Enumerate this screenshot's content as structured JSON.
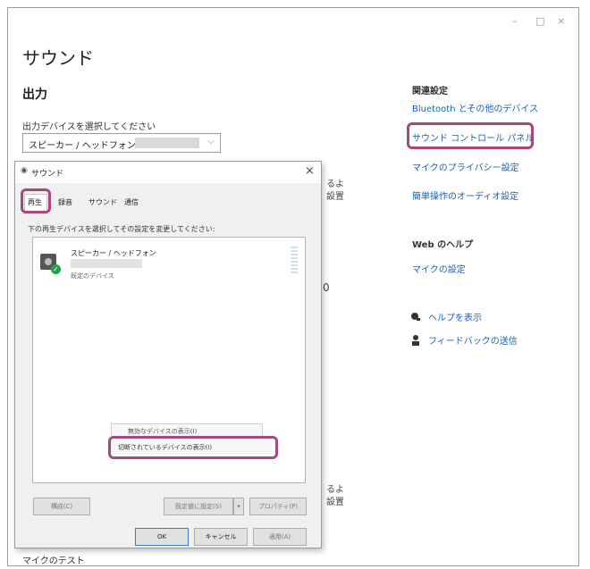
{
  "window": {
    "controls": {
      "minimize": "–",
      "maximize": "□",
      "close": "×"
    },
    "title": "サウンド",
    "output_heading": "出力",
    "output_device_label": "出力デバイスを選択してください",
    "output_device_value": "スピーカー / ヘッドフォン",
    "behind_fragments": {
      "a": "るよ",
      "b": "設置",
      "c": "0",
      "d": "るよ",
      "e": "設置"
    },
    "bottom_label": "マイクのテスト"
  },
  "related": {
    "heading": "関連設定",
    "links": [
      "Bluetooth とその他のデバイス",
      "サウンド コントロール パネル",
      "マイクのプライバシー設定",
      "簡単操作のオーディオ設定"
    ]
  },
  "web_help": {
    "heading": "Web のヘルプ",
    "link": "マイクの設定"
  },
  "help_items": [
    {
      "icon": "help-icon",
      "label": "ヘルプを表示"
    },
    {
      "icon": "feedback-icon",
      "label": "フィードバックの送信"
    }
  ],
  "dialog": {
    "title": "サウンド",
    "close": "×",
    "tabs": [
      "再生",
      "録音",
      "サウンド",
      "通信"
    ],
    "instruction": "下の再生デバイスを選択してその設定を変更してください:",
    "device": {
      "name": "スピーカー / ヘッドフォン",
      "status": "既定のデバイス"
    },
    "context_menu": [
      "無効なデバイスの表示(I)",
      "切断されているデバイスの表示(I)"
    ],
    "buttons": {
      "configure": "構成(C)",
      "set_default": "既定値に設定(S)",
      "set_default_arrow": "▾",
      "properties": "プロパティ(P)",
      "ok": "OK",
      "cancel": "キャンセル",
      "apply": "適用(A)"
    }
  },
  "colors": {
    "highlight": "#a9487d",
    "link": "#1f5fb0"
  }
}
